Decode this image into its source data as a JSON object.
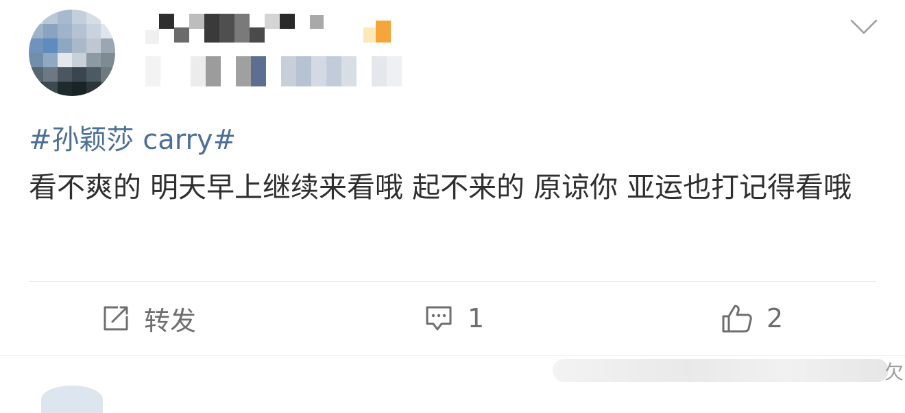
{
  "post": {
    "topic": "#孙颖莎 carry#",
    "content": "看不爽的 明天早上继续来看哦 起不来的 原谅你 亚运也打记得看哦"
  },
  "actions": {
    "repost_label": "转发",
    "comment_count": "1",
    "like_count": "2"
  },
  "watermark": {
    "tail_char": "欠"
  },
  "colors": {
    "topic": "#4c6f97",
    "text": "#2f2f2f",
    "action": "#6e6e6e",
    "divider": "#e8e8e8"
  },
  "icons": [
    "repost-icon",
    "comment-icon",
    "like-icon",
    "chevron-down-icon"
  ]
}
